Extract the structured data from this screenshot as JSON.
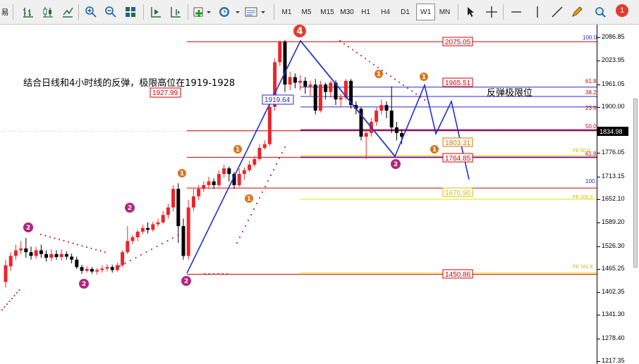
{
  "toolbar": {
    "timeframes": [
      "M1",
      "M5",
      "M15",
      "M30",
      "H1",
      "H4",
      "D1",
      "W1",
      "MN"
    ],
    "active_timeframe": "W1",
    "left_label": "易",
    "icons": [
      "bar-chart-icon",
      "candlestick-icon",
      "line-chart-icon",
      "zoom-in-icon",
      "zoom-out-icon",
      "tile-windows-icon",
      "autoscroll-icon",
      "chart-shift-icon",
      "indicators-icon",
      "periods-icon",
      "templates-icon",
      "cursor-icon",
      "crosshair-icon",
      "trendline-icon",
      "pencil-icon",
      "search-icon"
    ],
    "notification_count": "1"
  },
  "annotations": {
    "main_text": "结合日线和4小时线的反弹，极限高位在1919-1928",
    "rebound_text": "反弹极限位",
    "box_high": "1927.99",
    "box_low": "1919.64"
  },
  "price_axis": {
    "ticks": [
      "2086.85",
      "2023.95",
      "1961.05",
      "1900.00",
      "1838.05",
      "1776.05",
      "1713.15",
      "1652.10",
      "1589.20",
      "1526.30",
      "1465.25",
      "1402.35",
      "1341.30",
      "1278.40",
      "1217.35"
    ],
    "current_price": "1834.98"
  },
  "levels": [
    {
      "label": "2075.05",
      "price": 2075.05,
      "color": "#d40000"
    },
    {
      "label": "1965.51",
      "price": 1965.51,
      "color": "#d40000"
    },
    {
      "label": "1803.31",
      "price": 1803.31,
      "color": "#d47a00"
    },
    {
      "label": "1764.85",
      "price": 1764.85,
      "color": "#d40000"
    },
    {
      "label": "1670.90",
      "price": 1670.9,
      "color": "#d4c000"
    },
    {
      "label": "1450.86",
      "price": 1450.86,
      "color": "#d40000"
    }
  ],
  "fib_labels": [
    "100.0",
    "61.8",
    "38.2",
    "23.6",
    "50.0",
    "61.8",
    "100.0"
  ],
  "fe_labels": [
    "FE 50.0",
    "FE 100.0",
    "FE 161.8"
  ],
  "wave_markers": [
    "4",
    "1",
    "1",
    "1",
    "1",
    "1",
    "1",
    "2",
    "2",
    "2",
    "2",
    "2"
  ],
  "colors": {
    "bull": "#e8262a",
    "bear": "#000000",
    "wave_line": "#1f2fd0",
    "fib_line": "#d40000",
    "fib_line_alt": "#2a2abf",
    "yellow_level": "#e6e600",
    "marker_orange": "#d9741c",
    "marker_magenta": "#b1267f",
    "marker_red": "#e23b2e"
  }
}
